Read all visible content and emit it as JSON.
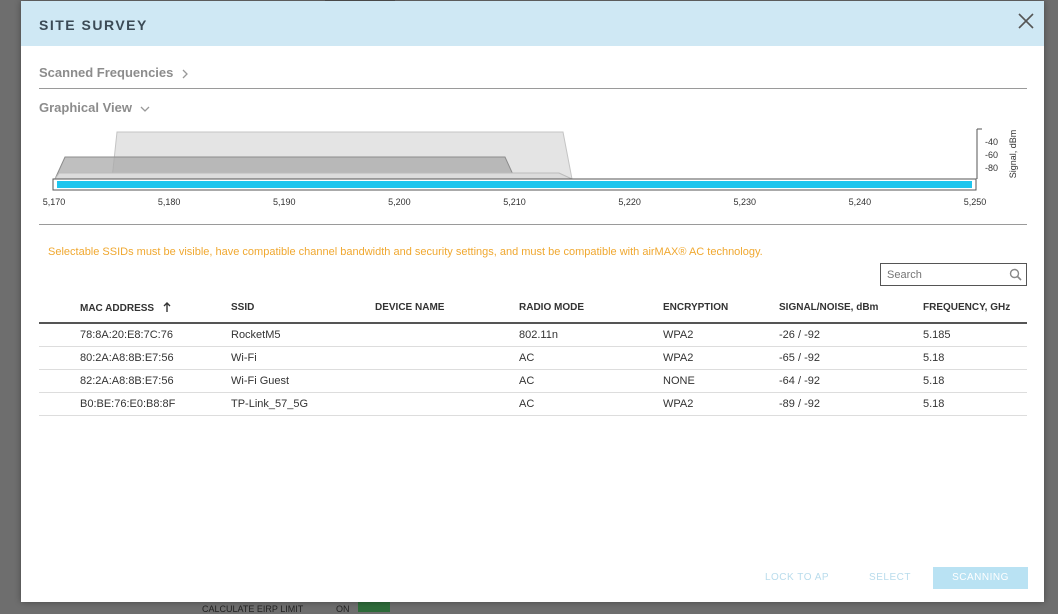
{
  "modal": {
    "title": "SITE SURVEY"
  },
  "sections": {
    "scanned_frequencies": "Scanned Frequencies",
    "graphical_view": "Graphical View"
  },
  "graph": {
    "x_ticks": [
      "5,170",
      "5,180",
      "5,190",
      "5,200",
      "5,210",
      "5,220",
      "5,230",
      "5,240",
      "5,250"
    ],
    "y_ticks": [
      "-40",
      "-60",
      "-80"
    ],
    "y_label": "Signal, dBm",
    "bar_color": "#1ec5ee"
  },
  "notice": "Selectable SSIDs must be visible, have compatible channel bandwidth and security settings, and must be compatible with airMAX® AC technology.",
  "search": {
    "placeholder": "Search"
  },
  "table": {
    "headers": {
      "mac": "MAC ADDRESS",
      "ssid": "SSID",
      "device": "DEVICE NAME",
      "radio": "RADIO MODE",
      "enc": "ENCRYPTION",
      "signal": "SIGNAL/NOISE, dBm",
      "freq": "FREQUENCY, GHz"
    },
    "rows": [
      {
        "mac": "78:8A:20:E8:7C:76",
        "ssid": "RocketM5",
        "device": "",
        "radio": "802.11n",
        "enc": "WPA2",
        "signal": "-26 / -92",
        "freq": "5.185"
      },
      {
        "mac": "80:2A:A8:8B:E7:56",
        "ssid": "Wi-Fi",
        "device": "",
        "radio": "AC",
        "enc": "WPA2",
        "signal": "-65 / -92",
        "freq": "5.18"
      },
      {
        "mac": "82:2A:A8:8B:E7:56",
        "ssid": "Wi-Fi Guest",
        "device": "",
        "radio": "AC",
        "enc": "NONE",
        "signal": "-64 / -92",
        "freq": "5.18"
      },
      {
        "mac": "B0:BE:76:E0:B8:8F",
        "ssid": "TP-Link_57_5G",
        "device": "",
        "radio": "AC",
        "enc": "WPA2",
        "signal": "-89 / -92",
        "freq": "5.18"
      }
    ]
  },
  "footer": {
    "lock_to_ap": "LOCK TO AP",
    "select": "SELECT",
    "scanning": "SCANNING"
  },
  "backdrop": {
    "partial_text": "CALCULATE EIRP LIMIT",
    "partial_value": "ON"
  }
}
